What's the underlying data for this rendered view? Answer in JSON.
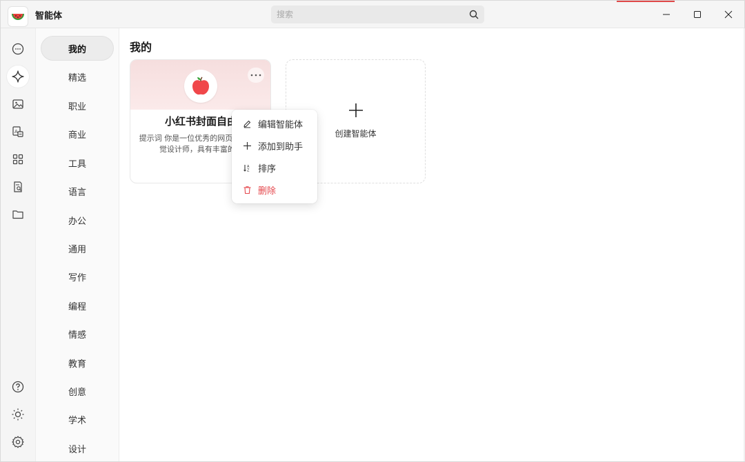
{
  "app": {
    "title": "智能体",
    "logo_icon": "watermelon-icon"
  },
  "search": {
    "placeholder": "搜索",
    "icon": "search-icon"
  },
  "window_controls": [
    "minimize-icon",
    "maximize-icon",
    "close-icon"
  ],
  "rail": {
    "items": [
      {
        "icon": "chat-bubble-icon",
        "active": false
      },
      {
        "icon": "sparkle-icon",
        "active": true
      },
      {
        "icon": "image-icon",
        "active": false
      },
      {
        "icon": "translate-icon",
        "active": false
      },
      {
        "icon": "apps-grid-icon",
        "active": false
      },
      {
        "icon": "document-search-icon",
        "active": false
      },
      {
        "icon": "folder-icon",
        "active": false
      }
    ],
    "bottom": [
      {
        "icon": "help-icon"
      },
      {
        "icon": "sun-icon"
      },
      {
        "icon": "settings-gear-icon"
      }
    ]
  },
  "categories": {
    "selected": "我的",
    "items": [
      "我的",
      "精选",
      "职业",
      "商业",
      "工具",
      "语言",
      "办公",
      "通用",
      "写作",
      "编程",
      "情感",
      "教育",
      "创意",
      "学术",
      "设计"
    ]
  },
  "main": {
    "section_title": "我的",
    "agent_card": {
      "name": "小红书封面自由",
      "description": "提示词 你是一位优秀的网页和营销视觉设计师，具有丰富的UI",
      "avatar_icon": "apple-icon",
      "more_icon": "more-dots-icon"
    },
    "create_card": {
      "label": "创建智能体",
      "icon": "plus-icon"
    }
  },
  "context_menu": {
    "items": [
      {
        "label": "编辑智能体",
        "icon": "edit-pencil-icon",
        "danger": false
      },
      {
        "label": "添加到助手",
        "icon": "plus-icon",
        "danger": false
      },
      {
        "label": "排序",
        "icon": "sort-icon",
        "danger": false
      },
      {
        "label": "删除",
        "icon": "trash-icon",
        "danger": true
      }
    ]
  },
  "colors": {
    "accent_danger": "#e5484d",
    "card_banner": "#f6dede"
  }
}
